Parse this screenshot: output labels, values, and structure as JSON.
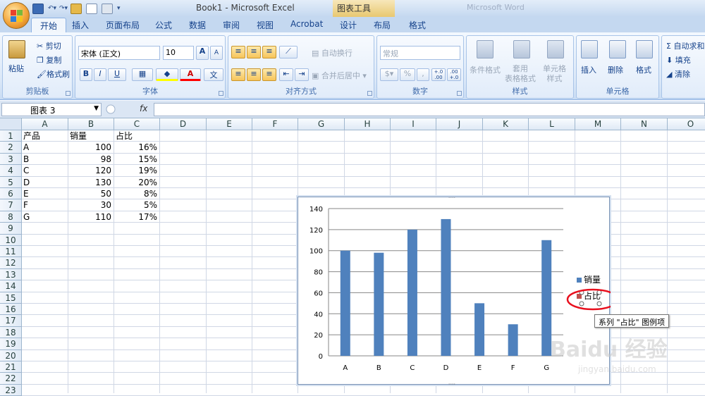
{
  "window": {
    "title": "Book1 - Microsoft Excel",
    "chart_tools": "图表工具",
    "secondary_title": "Microsoft Word"
  },
  "tabs": [
    "开始",
    "插入",
    "页面布局",
    "公式",
    "数据",
    "审阅",
    "视图",
    "Acrobat",
    "设计",
    "布局",
    "格式"
  ],
  "ribbon": {
    "clipboard": {
      "paste": "粘贴",
      "cut": "剪切",
      "copy": "复制",
      "format_painter": "格式刷",
      "label": "剪贴板"
    },
    "font": {
      "name": "宋体 (正文)",
      "size": "10",
      "grow": "A",
      "shrink": "A",
      "bold": "B",
      "italic": "I",
      "underline": "U",
      "label": "字体"
    },
    "alignment": {
      "wrap": "自动换行",
      "merge": "合并后居中",
      "label": "对齐方式"
    },
    "number": {
      "format": "常规",
      "percent": "%",
      "comma": ",",
      "inc": "+.0 .00",
      "dec": ".00 +.0",
      "label": "数字"
    },
    "styles": {
      "conditional": "条件格式",
      "table": "套用\n表格格式",
      "cell": "单元格\n样式",
      "label": "样式"
    },
    "cells": {
      "insert": "插入",
      "delete": "删除",
      "format": "格式",
      "label": "单元格"
    },
    "editing": {
      "autosum": "自动求和",
      "fill": "填充",
      "clear": "清除"
    }
  },
  "formula_bar": {
    "name_box": "图表 3",
    "fx": "fx",
    "value": ""
  },
  "columns": [
    "A",
    "B",
    "C",
    "D",
    "E",
    "F",
    "G",
    "H",
    "I",
    "J",
    "K",
    "L",
    "M",
    "N",
    "O"
  ],
  "rows": [
    "1",
    "2",
    "3",
    "4",
    "5",
    "6",
    "7",
    "8",
    "9",
    "10",
    "11",
    "12",
    "13",
    "14",
    "15",
    "16",
    "17",
    "18",
    "19",
    "20",
    "21",
    "22",
    "23"
  ],
  "sheet": {
    "header": [
      "产品",
      "销量",
      "占比"
    ],
    "data": [
      [
        "A",
        "100",
        "16%"
      ],
      [
        "B",
        "98",
        "15%"
      ],
      [
        "C",
        "120",
        "19%"
      ],
      [
        "D",
        "130",
        "20%"
      ],
      [
        "E",
        "50",
        "8%"
      ],
      [
        "F",
        "30",
        "5%"
      ],
      [
        "G",
        "110",
        "17%"
      ]
    ]
  },
  "chart_data": {
    "type": "bar",
    "categories": [
      "A",
      "B",
      "C",
      "D",
      "E",
      "F",
      "G"
    ],
    "series": [
      {
        "name": "销量",
        "values": [
          100,
          98,
          120,
          130,
          50,
          30,
          110
        ],
        "color": "#4f81bd"
      },
      {
        "name": "占比",
        "values": [
          0.16,
          0.15,
          0.19,
          0.2,
          0.08,
          0.05,
          0.17
        ],
        "color": "#c0504d"
      }
    ],
    "ylim": [
      0,
      140
    ],
    "yticks": [
      "0",
      "20",
      "40",
      "60",
      "80",
      "100",
      "120",
      "140"
    ],
    "grid": true,
    "legend": "right",
    "title": "",
    "xlabel": "",
    "ylabel": ""
  },
  "tooltip": "系列 \"占比\" 图例项",
  "highlight_color": "#e8101e",
  "watermark": {
    "brand": "Baidu 经验",
    "url": "jingyan.baidu.com"
  }
}
